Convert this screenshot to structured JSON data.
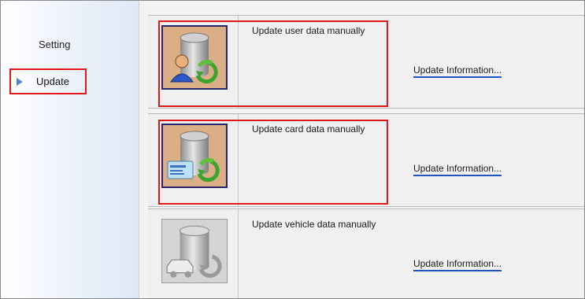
{
  "sidebar": {
    "items": [
      {
        "label": "Setting"
      },
      {
        "label": "Update"
      }
    ]
  },
  "rows": [
    {
      "title": "Update user data manually",
      "link": "Update Information...",
      "icon": "user-database-sync-icon",
      "enabled": true,
      "highlighted": true
    },
    {
      "title": "Update card data manually",
      "link": "Update Information...",
      "icon": "card-database-sync-icon",
      "enabled": true,
      "highlighted": true
    },
    {
      "title": "Update vehicle data manually",
      "link": "Update Information...",
      "icon": "vehicle-database-sync-icon",
      "enabled": false,
      "highlighted": false
    }
  ],
  "colors": {
    "highlight": "#e01818",
    "link_underline": "#1f54c4",
    "nav_arrow": "#4f86d9",
    "icon_active_bg": "#d8a77e"
  }
}
